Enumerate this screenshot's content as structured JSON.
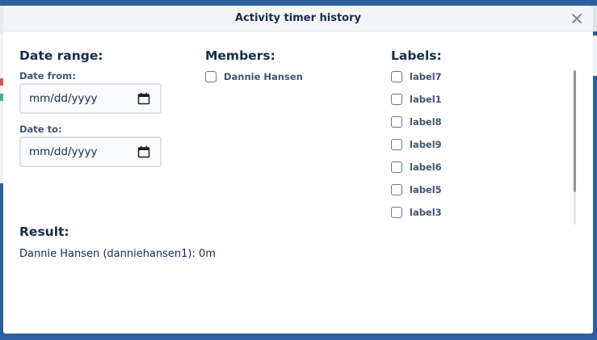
{
  "modal": {
    "title": "Activity timer history"
  },
  "date_range": {
    "title": "Date range:",
    "from_label": "Date from:",
    "from_value": "mm/dd/yyyy",
    "to_label": "Date to:",
    "to_value": "mm/dd/yyyy"
  },
  "members": {
    "title": "Members:",
    "items": [
      {
        "label": "Dannie Hansen",
        "checked": false
      }
    ]
  },
  "labels": {
    "title": "Labels:",
    "items": [
      {
        "label": "label7",
        "checked": false
      },
      {
        "label": "label1",
        "checked": false
      },
      {
        "label": "label8",
        "checked": false
      },
      {
        "label": "label9",
        "checked": false
      },
      {
        "label": "label6",
        "checked": false
      },
      {
        "label": "label5",
        "checked": false
      },
      {
        "label": "label3",
        "checked": false
      }
    ]
  },
  "result": {
    "title": "Result:",
    "text": "Dannie Hansen (danniehansen1): 0m"
  },
  "icons": {
    "close": "close-icon",
    "calendar": "calendar-icon"
  },
  "colors": {
    "backdrop": "#2d5f9e",
    "heading": "#172b4d",
    "label": "#44546f"
  }
}
